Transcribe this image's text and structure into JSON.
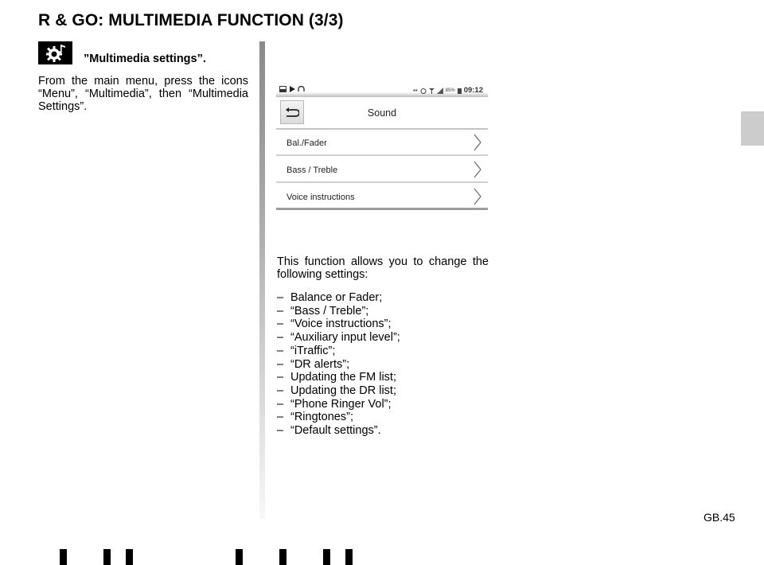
{
  "page": {
    "title": "R & GO: MULTIMEDIA FUNCTION (3/3)",
    "section": {
      "icon": "multimedia-settings-icon",
      "heading": "”Multimedia settings”.",
      "intro": "From the main menu, press the icons “Menu”, “Multimedia”, then “Multimedia Settings”."
    },
    "page_number": "GB.45"
  },
  "screen": {
    "statusbar": {
      "left_icons": [
        "image-icon",
        "play-icon",
        "headphones-icon"
      ],
      "right_icons": [
        "media-icon",
        "alarm-icon",
        "signal-icon",
        "network-bars-icon",
        "battery-icon"
      ],
      "battery": "85%",
      "time": "09:12"
    },
    "back_icon": "back-arrow-icon",
    "title": "Sound",
    "menu_items": [
      {
        "label": "Bal./Fader"
      },
      {
        "label": "Bass / Treble"
      },
      {
        "label": "Voice instructions"
      }
    ]
  },
  "body": {
    "description": "This function allows you to change the following settings:",
    "dash": "–",
    "settings": [
      "Balance or Fader;",
      "“Bass / Treble”;",
      "“Voice instructions”;",
      "“Auxiliary input level”;",
      "“iTraffic”;",
      "“DR alerts”;",
      "Updating the FM list;",
      "Updating the DR list;",
      "“Phone Ringer Vol”;",
      "“Ringtones”;",
      "“Default settings”."
    ]
  }
}
